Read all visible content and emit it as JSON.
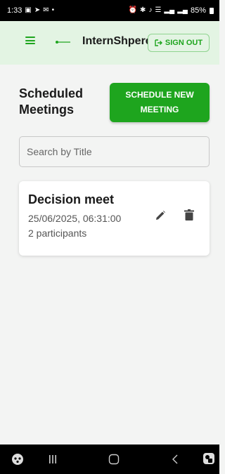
{
  "status_bar": {
    "time": "1:33",
    "battery": "85%",
    "left_icons": [
      "gallery-icon",
      "send-icon",
      "mail-icon",
      "dot-icon"
    ],
    "right_icons": [
      "alarm-icon",
      "bluetooth-icon",
      "mute-icon",
      "wifi-icon",
      "signal-icon",
      "signal-icon"
    ]
  },
  "app_bar": {
    "title": "InternShpere",
    "signout_label": "SIGN OUT"
  },
  "main": {
    "title": "Scheduled Meetings",
    "schedule_button_label": "SCHEDULE NEW MEETING",
    "search_placeholder": "Search by Title"
  },
  "meetings": [
    {
      "title": "Decision meet",
      "datetime": "25/06/2025, 06:31:00",
      "participants": "2 participants"
    }
  ],
  "colors": {
    "accent": "#1ea51e",
    "app_bar_bg": "#e3f4e3",
    "page_bg": "#f3f4f3"
  }
}
